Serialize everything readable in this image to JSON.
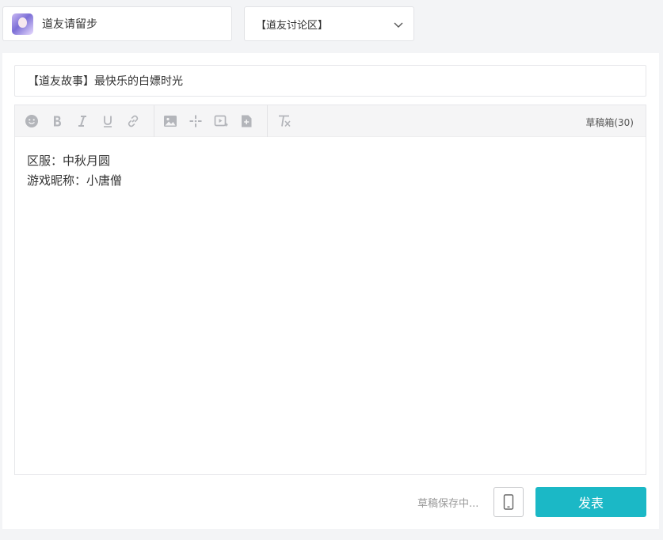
{
  "header": {
    "user_name": "道友请留步",
    "board_selected": "【道友讨论区】"
  },
  "post": {
    "title": "【道友故事】最快乐的白嫖时光",
    "body_lines": [
      "区服：中秋月圆",
      "游戏昵称：小唐僧"
    ]
  },
  "toolbar": {
    "drafts_label": "草稿箱(30)",
    "icons": [
      "emoji-icon",
      "bold-icon",
      "italic-icon",
      "underline-icon",
      "link-icon",
      "image-icon",
      "sparkle-icon",
      "video-icon",
      "attachment-icon",
      "clear-format-icon"
    ]
  },
  "footer": {
    "status": "草稿保存中...",
    "publish_label": "发表"
  },
  "colors": {
    "accent": "#1bb8c6",
    "icon": "#b3b5ba",
    "background": "#f3f4f6"
  }
}
